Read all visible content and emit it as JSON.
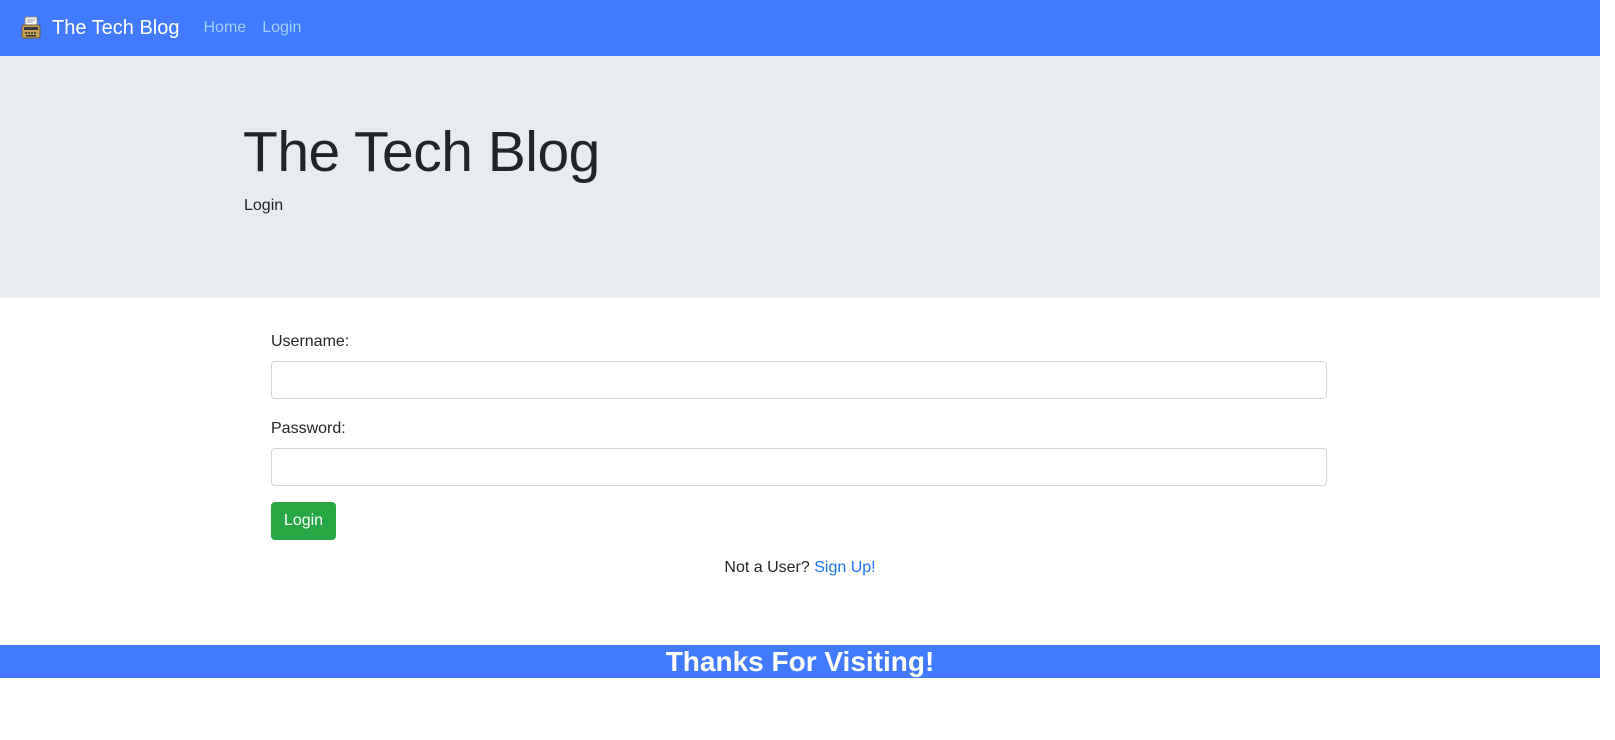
{
  "navbar": {
    "brand_icon": "typewriter-icon",
    "brand": "The Tech Blog",
    "links": [
      {
        "label": "Home"
      },
      {
        "label": "Login"
      }
    ],
    "background_color": "#407bff",
    "link_color": "#9fd0ff"
  },
  "jumbotron": {
    "title": "The Tech Blog",
    "subtitle": "Login",
    "background_color": "#e9ecef"
  },
  "form": {
    "username_label": "Username:",
    "username_value": "",
    "password_label": "Password:",
    "password_value": "",
    "submit_label": "Login",
    "submit_color": "#28a745"
  },
  "signup": {
    "prompt": "Not a User?",
    "link": "Sign Up!",
    "link_color": "#1a73e8"
  },
  "footer": {
    "text": "Thanks For Visiting!",
    "background_color": "#407bff"
  }
}
